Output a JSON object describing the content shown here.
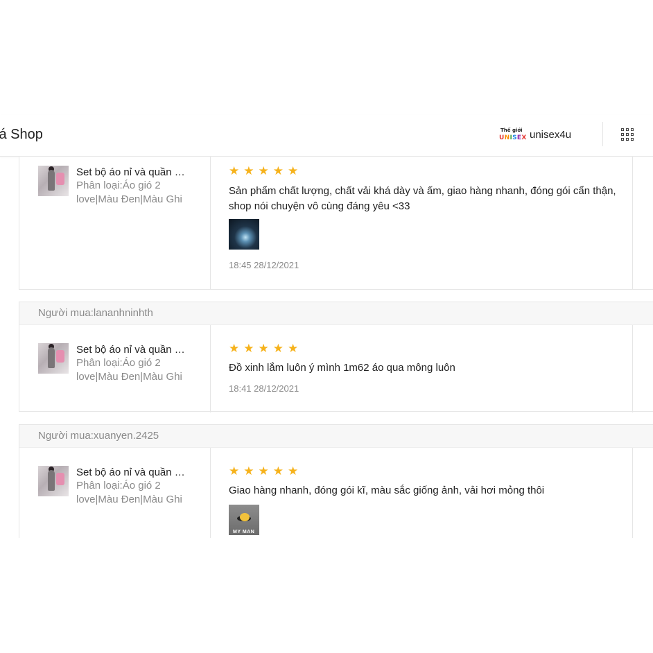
{
  "header": {
    "title": "iá Shop",
    "shop_logo_top": "Thế giới",
    "shop_logo_bottom": "UNISEX",
    "shop_name": "unisex4u"
  },
  "icons": {
    "menu": "grid-icon",
    "rating": "star-icon"
  },
  "colors": {
    "star": "#f6b21b",
    "muted_text": "#8a8a8a",
    "border": "#e6e6e6"
  },
  "reviews": [
    {
      "buyer": "",
      "product_name": "Set bộ áo nỉ và quần …",
      "variant": "Phân loại:Áo gió 2 love|Màu Đen|Màu Ghi",
      "rating": 5,
      "comment": "Sản phẩm chất lượng, chất vải khá dày và ấm, giao hàng nhanh, đóng gói cẩn thận, shop nói chuyện vô cùng đáng yêu <33",
      "has_photo": true,
      "time": "18:45 28/12/2021"
    },
    {
      "buyer": "Người mua:lananhninhth",
      "product_name": "Set bộ áo nỉ và quần …",
      "variant": "Phân loại:Áo gió 2 love|Màu Đen|Màu Ghi",
      "rating": 5,
      "comment": "Đồ xinh lắm luôn ý mình 1m62 áo qua mông luôn",
      "has_photo": false,
      "time": "18:41 28/12/2021"
    },
    {
      "buyer": "Người mua:xuanyen.2425",
      "product_name": "Set bộ áo nỉ và quần …",
      "variant": "Phân loại:Áo gió 2 love|Màu Đen|Màu Ghi",
      "rating": 5,
      "comment": "Giao hàng nhanh, đóng gói kĩ, màu sắc giống ảnh, vải hơi mỏng thôi",
      "has_photo": true,
      "photo_caption": "MY MAN",
      "time": ""
    }
  ]
}
